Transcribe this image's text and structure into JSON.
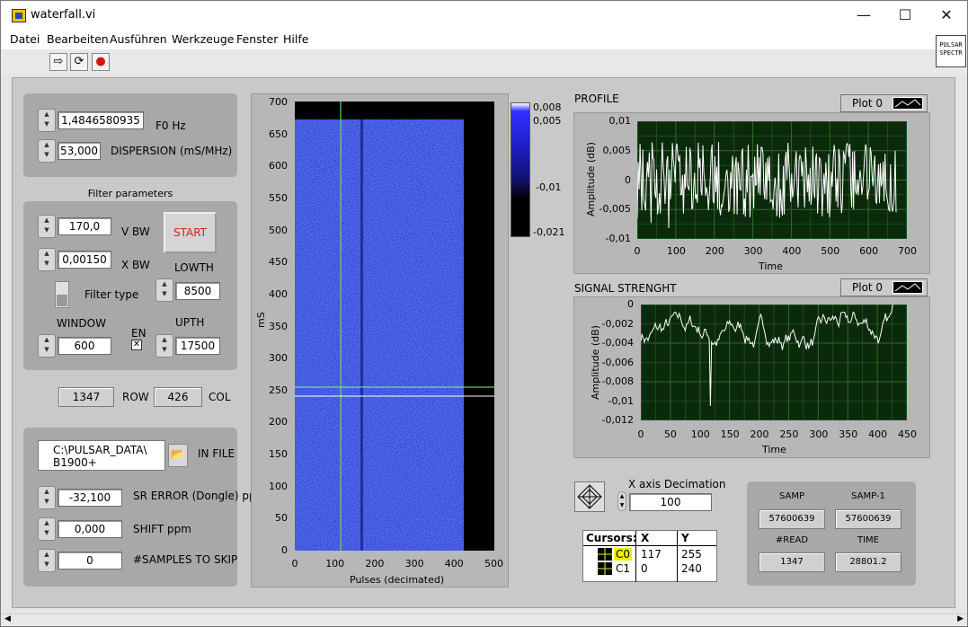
{
  "window": {
    "title": "waterfall.vi",
    "minimize": "—",
    "maximize": "☐",
    "close": "✕"
  },
  "menu": [
    "Datei",
    "Bearbeiten",
    "Ausführen",
    "Werkzeuge",
    "Fenster",
    "Hilfe"
  ],
  "toolbar": {
    "run": "⇨",
    "run_continuous": "⟳",
    "abort": "●"
  },
  "vi_icon": "PULSAR\nSPECTR",
  "controls": {
    "f0": {
      "value": "1,4846580935",
      "label": "F0 Hz"
    },
    "dispersion": {
      "value": "53,000",
      "label": "DISPERSION (mS/MHz)"
    },
    "filter_header": "Filter parameters",
    "vbw": {
      "value": "170,0",
      "label": "V BW"
    },
    "xbw": {
      "value": "0,00150",
      "label": "X BW"
    },
    "start_label": "START",
    "lowth": {
      "value": "8500",
      "label": "LOWTH"
    },
    "filter_type_label": "Filter type",
    "window": {
      "value": "600",
      "label": "WINDOW"
    },
    "en_label": "EN",
    "upth": {
      "value": "17500",
      "label": "UPTH"
    },
    "row": {
      "value": "1347",
      "label": "ROW"
    },
    "col": {
      "value": "426",
      "label": "COL"
    },
    "infile": {
      "value": "C:\\PULSAR_DATA\\\nB1900+",
      "label": "IN FILE"
    },
    "sr_error": {
      "value": "-32,100",
      "label": "SR ERROR (Dongle) ppm"
    },
    "shift": {
      "value": "0,000",
      "label": "SHIFT ppm"
    },
    "skip": {
      "value": "0",
      "label": "#SAMPLES TO SKIP"
    }
  },
  "waterfall": {
    "ylabel": "mS",
    "xlabel": "Pulses (decimated)",
    "yticks": [
      "700",
      "650",
      "600",
      "550",
      "500",
      "450",
      "400",
      "350",
      "300",
      "250",
      "200",
      "150",
      "100",
      "50",
      "0"
    ],
    "xticks": [
      "0",
      "100",
      "200",
      "300",
      "400",
      "500"
    ],
    "colorbar_ticks": [
      "0,008",
      "0,005",
      "-0,01",
      "-0,021"
    ]
  },
  "profile": {
    "title": "PROFILE",
    "plot_legend": "Plot 0",
    "ylabel": "Amplitude (dB)",
    "xlabel": "Time",
    "yticks": [
      "0,01",
      "0,005",
      "0",
      "-0,005",
      "-0,01"
    ],
    "xticks": [
      "0",
      "100",
      "200",
      "300",
      "400",
      "500",
      "600",
      "700"
    ]
  },
  "signal": {
    "title": "SIGNAL STRENGHT",
    "plot_legend": "Plot 0",
    "ylabel": "Amplitude (dB)",
    "xlabel": "Time",
    "yticks": [
      "0",
      "-0,002",
      "-0,004",
      "-0,006",
      "-0,008",
      "-0,01",
      "-0,012"
    ],
    "xticks": [
      "0",
      "50",
      "100",
      "150",
      "200",
      "250",
      "300",
      "350",
      "400",
      "450"
    ]
  },
  "decimation": {
    "label": "X axis Decimation",
    "value": "100"
  },
  "cursors": {
    "headers": [
      "Cursors:",
      "X",
      "Y"
    ],
    "rows": [
      {
        "name": "C0",
        "x": "117",
        "y": "255"
      },
      {
        "name": "C1",
        "x": "0",
        "y": "240"
      }
    ]
  },
  "stats": {
    "samp": {
      "label": "SAMP",
      "value": "57600639"
    },
    "samp1": {
      "label": "SAMP-1",
      "value": "57600639"
    },
    "read": {
      "label": "#READ",
      "value": "1347"
    },
    "time": {
      "label": "TIME",
      "value": "28801.2"
    }
  },
  "colors": {
    "plot_bg": "#0b2a0b",
    "grid": "#2e6b2e",
    "trace": "#ffffff",
    "waterfall_blue": "#2d3fd8",
    "cursor": "#7cff7c"
  }
}
